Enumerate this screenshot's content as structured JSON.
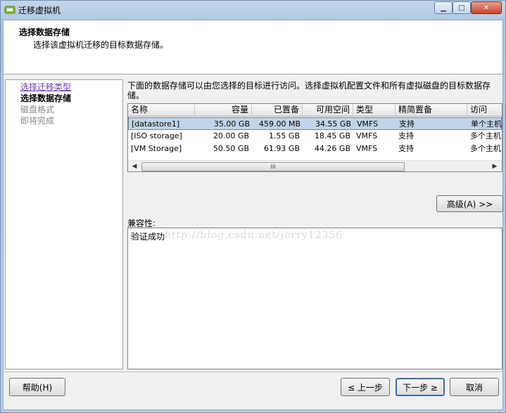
{
  "window": {
    "title": "迁移虚拟机"
  },
  "header": {
    "title": "选择数据存储",
    "subtitle": "选择该虚拟机迁移的目标数据存储。"
  },
  "sidebar": {
    "items": [
      {
        "label": "选择迁移类型",
        "state": "link"
      },
      {
        "label": "选择数据存储",
        "state": "current"
      },
      {
        "label": "磁盘格式",
        "state": "future"
      },
      {
        "label": "即将完成",
        "state": "future"
      }
    ]
  },
  "main": {
    "instructions": "下面的数据存储可以由您选择的目标进行访问。选择虚拟机配置文件和所有虚拟磁盘的目标数据存储。",
    "table": {
      "columns": [
        "名称",
        "容量",
        "已置备",
        "可用空间",
        "类型",
        "精简置备",
        "访问"
      ],
      "rows": [
        [
          "[datastore1]",
          "35.00 GB",
          "459.00 MB",
          "34.55 GB",
          "VMFS",
          "支持",
          "单个主机"
        ],
        [
          "[ISO storage]",
          "20.00 GB",
          "1.55 GB",
          "18.45 GB",
          "VMFS",
          "支持",
          "多个主机"
        ],
        [
          "[VM Storage]",
          "50.50 GB",
          "61.93 GB",
          "44.26 GB",
          "VMFS",
          "支持",
          "多个主机"
        ]
      ],
      "selected_row": 0,
      "scroll_thumb": "III"
    },
    "advanced_button": "高级(A) >>",
    "compat_label": "兼容性:",
    "compat_text": "验证成功",
    "watermark": "http://blog.csdn.net/jerry12356"
  },
  "footer": {
    "help": "帮助(H)",
    "back": "≤ 上一步",
    "next": "下一步 ≥",
    "cancel": "取消"
  },
  "colors": {
    "selection": "#c1d5ea",
    "link": "#6a3db8"
  }
}
